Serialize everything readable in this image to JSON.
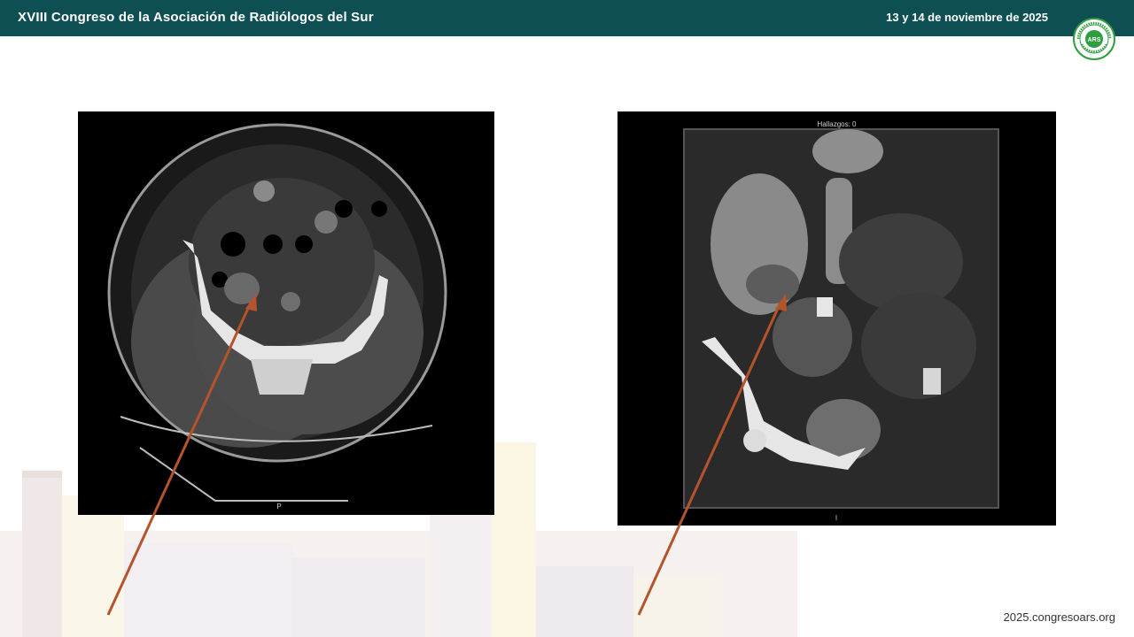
{
  "header": {
    "title": "XVIII Congreso de la Asociación de Radiólogos del Sur",
    "date": "13 y 14 de noviembre de 2025"
  },
  "logo": {
    "abbr": "ARS",
    "ring_top": "ASOCIACIÓN RADIÓLOGOS",
    "ring_bottom": "SUR"
  },
  "scan_left": {
    "caption": "P"
  },
  "scan_right": {
    "caption_top": "Hallazgos: 0",
    "caption_bottom": "I"
  },
  "footer": {
    "url": "2025.congresoars.org"
  },
  "colors": {
    "header_bg": "#0e4f53",
    "arrow": "#b5542b",
    "logo_green": "#2e9e3f"
  }
}
